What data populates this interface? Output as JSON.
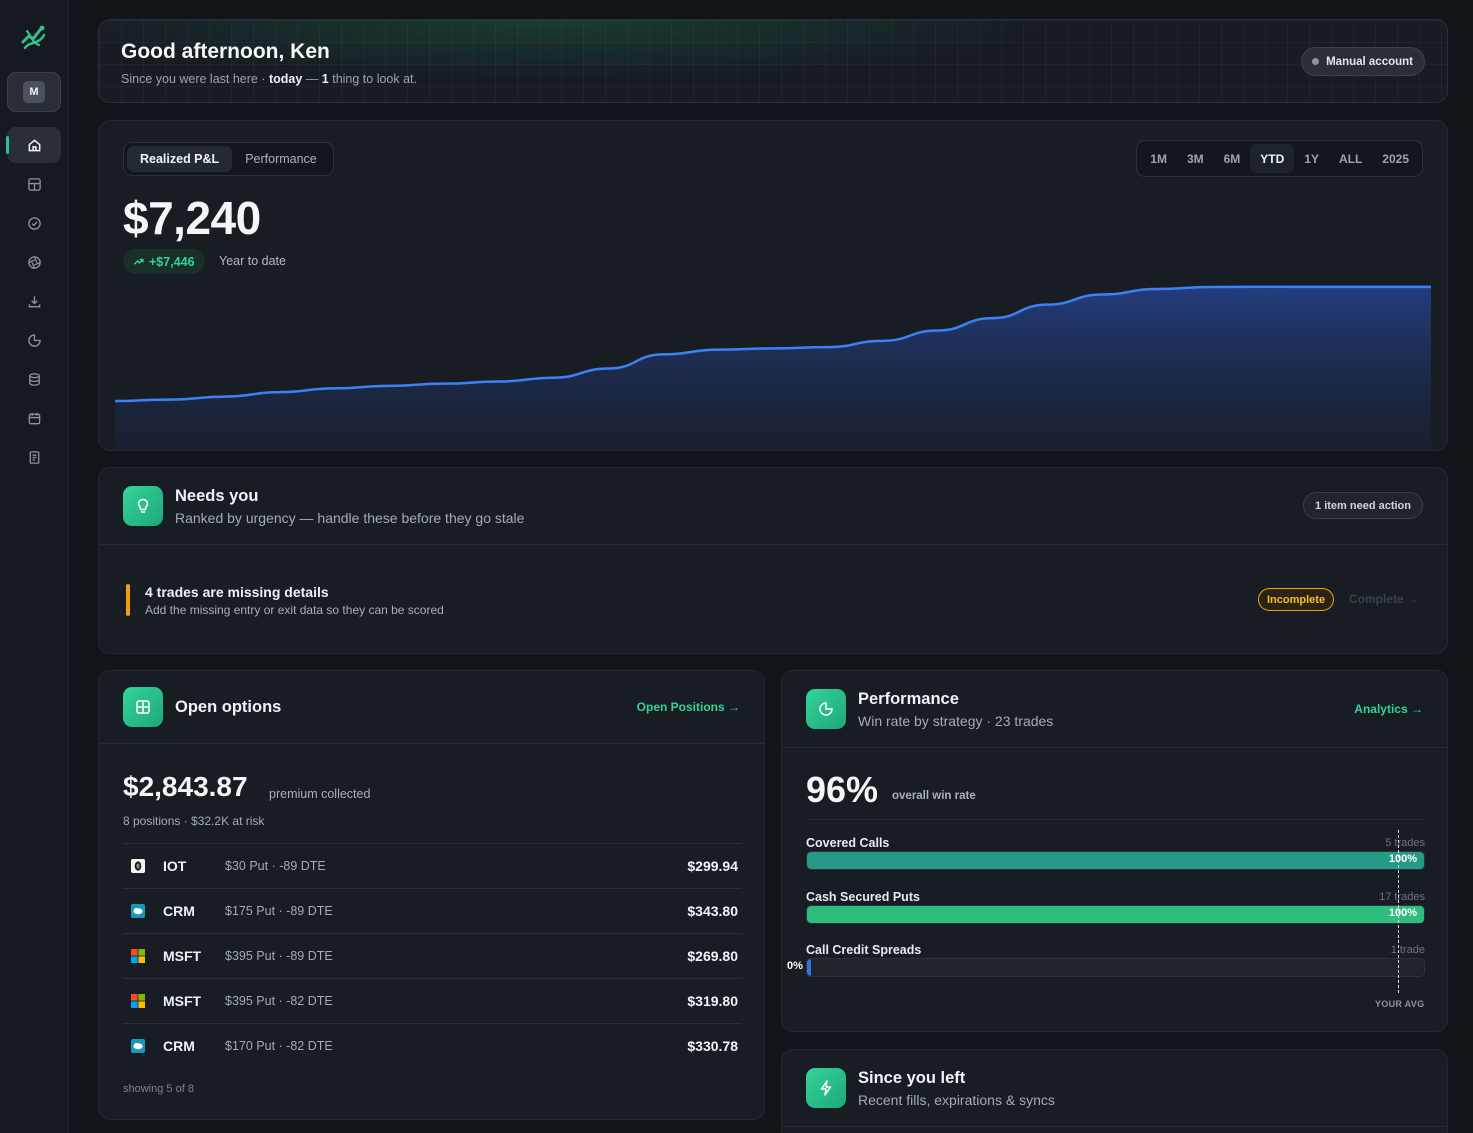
{
  "sidebar": {
    "avatar_initial": "M",
    "nav": [
      "home-icon",
      "layout-icon",
      "check-circle-icon",
      "aperture-icon",
      "download-icon",
      "pie-chart-icon",
      "database-icon",
      "calendar-icon",
      "notebook-icon"
    ]
  },
  "greeting": {
    "title": "Good afternoon, Ken",
    "sub_prefix": "Since you were last here · ",
    "sub_when": "today",
    "sub_dash": " — ",
    "sub_count": "1",
    "sub_suffix": " thing to look at.",
    "account_badge": "Manual account"
  },
  "pnl": {
    "tabs": [
      "Realized P&L",
      "Performance"
    ],
    "active_tab": 0,
    "ranges": [
      "1M",
      "3M",
      "6M",
      "YTD",
      "1Y",
      "ALL",
      "2025"
    ],
    "active_range": 3,
    "value": "$7,240",
    "change": "+$7,446",
    "change_label": "Year to date",
    "accent": "#3b82f6"
  },
  "chart_data": {
    "type": "area",
    "title": "",
    "xlabel": "",
    "ylabel": "",
    "x": [
      0,
      1,
      2,
      3,
      4,
      5,
      6,
      7,
      8,
      9,
      10,
      11,
      12,
      13,
      14,
      15,
      16,
      17,
      18,
      19,
      20,
      21,
      22,
      23,
      24
    ],
    "values": [
      0,
      90,
      280,
      560,
      800,
      960,
      1100,
      1240,
      1480,
      2060,
      2960,
      3260,
      3340,
      3420,
      3820,
      4480,
      5260,
      6120,
      6760,
      7110,
      7240,
      7250,
      7250,
      7250,
      7250
    ],
    "ylim": [
      0,
      8000
    ],
    "grid": false,
    "legend": "none"
  },
  "needs": {
    "title": "Needs you",
    "subtitle": "Ranked by urgency — handle these before they go stale",
    "action_pill": "1 item need action",
    "item_title": "4 trades are missing details",
    "item_sub": "Add the missing entry or exit data so they can be scored",
    "item_status": "Incomplete",
    "item_link": "Complete →"
  },
  "open_options": {
    "title": "Open options",
    "link": "Open Positions →",
    "premium": "$2,843.87",
    "premium_label": "premium collected",
    "meta": "8 positions · $32.2K at risk",
    "rows": [
      {
        "logo": "iot-logo-icon",
        "symbol": "IOT",
        "desc": "$30 Put · -89 DTE",
        "amount": "$299.94"
      },
      {
        "logo": "salesforce-logo-icon",
        "symbol": "CRM",
        "desc": "$175 Put · -89 DTE",
        "amount": "$343.80"
      },
      {
        "logo": "microsoft-logo-icon",
        "symbol": "MSFT",
        "desc": "$395 Put · -89 DTE",
        "amount": "$269.80"
      },
      {
        "logo": "microsoft-logo-icon",
        "symbol": "MSFT",
        "desc": "$395 Put · -82 DTE",
        "amount": "$319.80"
      },
      {
        "logo": "salesforce-logo-icon",
        "symbol": "CRM",
        "desc": "$170 Put · -82 DTE",
        "amount": "$330.78"
      }
    ],
    "showing": "showing 5 of 8"
  },
  "performance": {
    "title": "Performance",
    "subtitle": "Win rate by strategy · 23 trades",
    "link": "Analytics →",
    "win_rate": "96%",
    "win_rate_label": "overall win rate",
    "avg_label": "YOUR AVG",
    "avg_value": 96,
    "strategies": [
      {
        "name": "Covered Calls",
        "count": "5 trades",
        "pct_label": "100%",
        "value": 100,
        "color": "#259b86"
      },
      {
        "name": "Cash Secured Puts",
        "count": "17 trades",
        "pct_label": "100%",
        "value": 100,
        "color": "#2fbd7f"
      },
      {
        "name": "Call Credit Spreads",
        "count": "1 trade",
        "pct_label": "0%",
        "value": 0,
        "color": "#3b6fe0"
      }
    ]
  },
  "since": {
    "title": "Since you left",
    "subtitle": "Recent fills, expirations & syncs"
  }
}
